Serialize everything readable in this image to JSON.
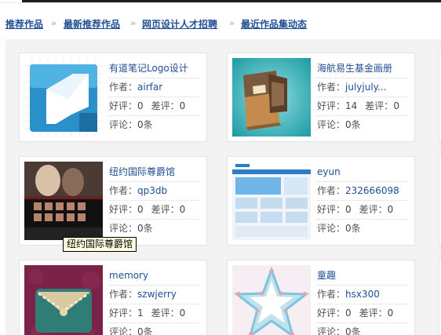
{
  "breadcrumb": {
    "items": [
      "推荐作品",
      "最新推荐作品",
      "网页设计人才招聘",
      "最近作品集动态"
    ],
    "separator": "»"
  },
  "labels": {
    "author": "作者：",
    "good": "好评：",
    "bad": "差评：",
    "comment": "评论：",
    "comment_unit": "条"
  },
  "works": [
    {
      "title": "有道笔记Logo设计",
      "author": "airfar",
      "good": "0",
      "bad": "0",
      "comments": "0",
      "thumb": "logo-icon"
    },
    {
      "title": "海航易生基金画册",
      "author": "julyjuly...",
      "good": "14",
      "bad": "0",
      "comments": "0",
      "thumb": "brochure-image"
    },
    {
      "title": "纽约国际尊爵馆",
      "author": "qp3db",
      "good": "0",
      "bad": "0",
      "comments": "0",
      "thumb": "website-screenshot"
    },
    {
      "title": "eyun",
      "author": "232666098",
      "good": "0",
      "bad": "0",
      "comments": "0",
      "thumb": "portal-screenshot"
    },
    {
      "title": "memory",
      "author": "szwjerry",
      "good": "1",
      "bad": "0",
      "comments": "0",
      "thumb": "envelope-icon"
    },
    {
      "title": "童趣",
      "author": "hsx300",
      "good": "0",
      "bad": "0",
      "comments": "0",
      "thumb": "star-frame-image"
    }
  ],
  "tooltip": {
    "text": "纽约国际尊爵馆"
  },
  "colors": {
    "link": "#1f4e93",
    "panel": "#f3f3f3",
    "tooltip_bg": "#ffffe1"
  }
}
